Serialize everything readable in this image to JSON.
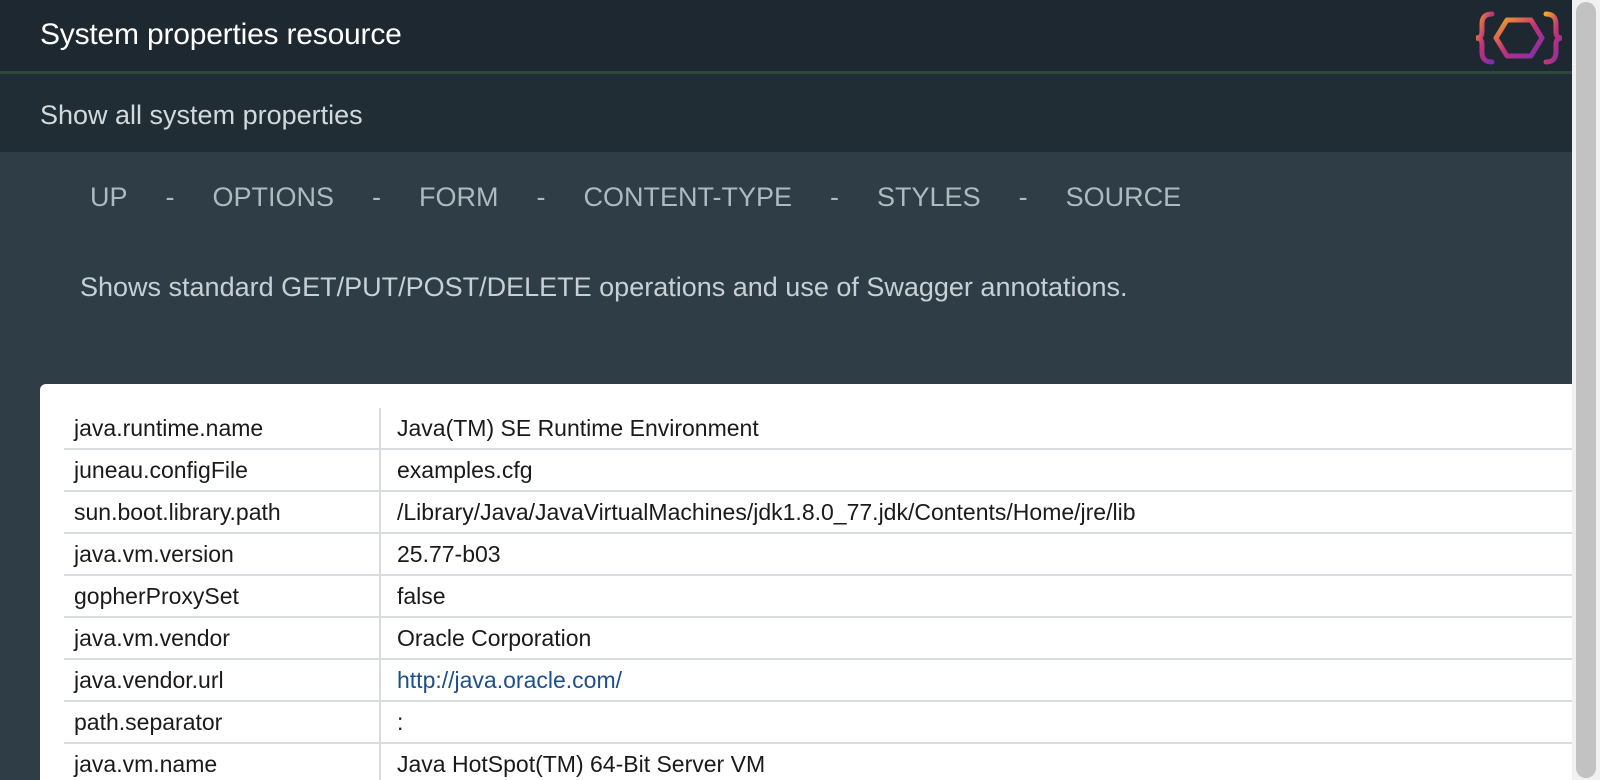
{
  "header": {
    "title": "System properties resource",
    "logo_icon": "juneau-logo-icon"
  },
  "subheader": {
    "text": "Show all system properties"
  },
  "nav": {
    "links": [
      "UP",
      "OPTIONS",
      "FORM",
      "CONTENT-TYPE",
      "STYLES",
      "SOURCE"
    ],
    "separator": "-"
  },
  "description": "Shows standard GET/PUT/POST/DELETE operations and use of Swagger annotations.",
  "properties": [
    {
      "key": "java.runtime.name",
      "value": "Java(TM) SE Runtime Environment"
    },
    {
      "key": "juneau.configFile",
      "value": "examples.cfg"
    },
    {
      "key": "sun.boot.library.path",
      "value": "/Library/Java/JavaVirtualMachines/jdk1.8.0_77.jdk/Contents/Home/jre/lib"
    },
    {
      "key": "java.vm.version",
      "value": "25.77-b03"
    },
    {
      "key": "gopherProxySet",
      "value": "false"
    },
    {
      "key": "java.vm.vendor",
      "value": "Oracle Corporation"
    },
    {
      "key": "java.vendor.url",
      "value": "http://java.oracle.com/"
    },
    {
      "key": "path.separator",
      "value": ":"
    },
    {
      "key": "java.vm.name",
      "value": "Java HotSpot(TM) 64-Bit Server VM"
    }
  ],
  "colors": {
    "header_bg": "#1d2830",
    "subheader_bg": "#212d35",
    "page_bg": "#2f3d46",
    "link": "#1f4f8a"
  }
}
